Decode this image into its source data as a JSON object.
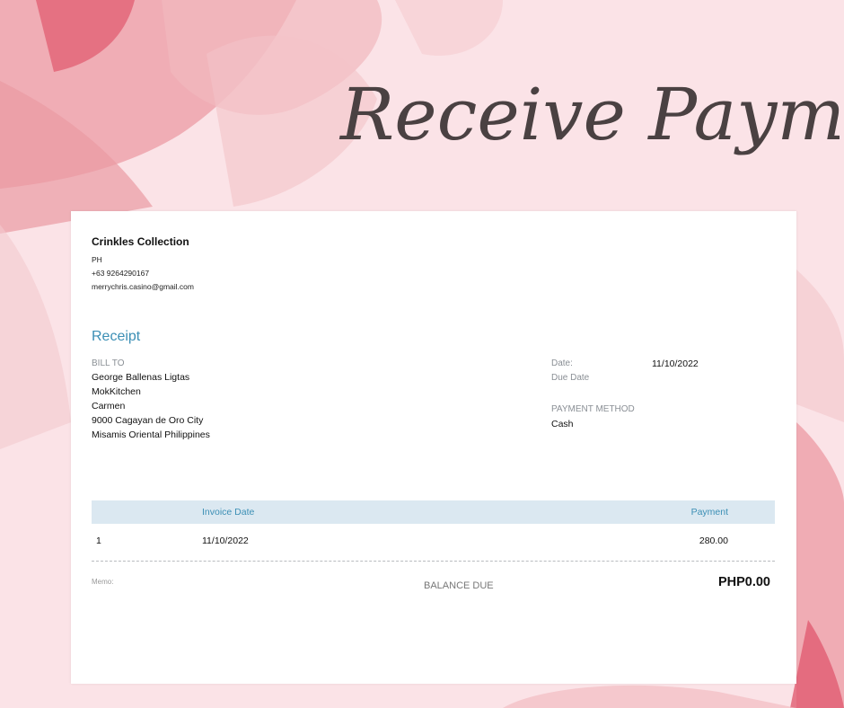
{
  "page": {
    "heading": "Receive Payment",
    "colors": {
      "background": "#fbe3e7",
      "accent": "#3c8fb5",
      "script": "#4a4142"
    }
  },
  "company": {
    "name": "Crinkles Collection",
    "country": "PH",
    "phone": "+63 9264290167",
    "email": "merrychris.casino@gmail.com"
  },
  "receipt": {
    "title": "Receipt",
    "bill_to_label": "BILL TO",
    "bill_to_lines": [
      "George Ballenas Ligtas",
      "MokKitchen",
      "Carmen",
      "9000 Cagayan de Oro City",
      "Misamis Oriental Philippines"
    ],
    "date_label": "Date:",
    "date_value": "11/10/2022",
    "due_date_label": "Due Date",
    "payment_method_label": "PAYMENT METHOD",
    "payment_method_value": "Cash"
  },
  "table": {
    "headers": {
      "number": "",
      "invoice_date": "Invoice Date",
      "payment": "Payment"
    },
    "rows": [
      {
        "number": "1",
        "invoice_date": "11/10/2022",
        "payment": "280.00"
      }
    ]
  },
  "footer": {
    "memo_label": "Memo:",
    "balance_due_label": "BALANCE DUE",
    "balance_due_value": "PHP0.00"
  }
}
